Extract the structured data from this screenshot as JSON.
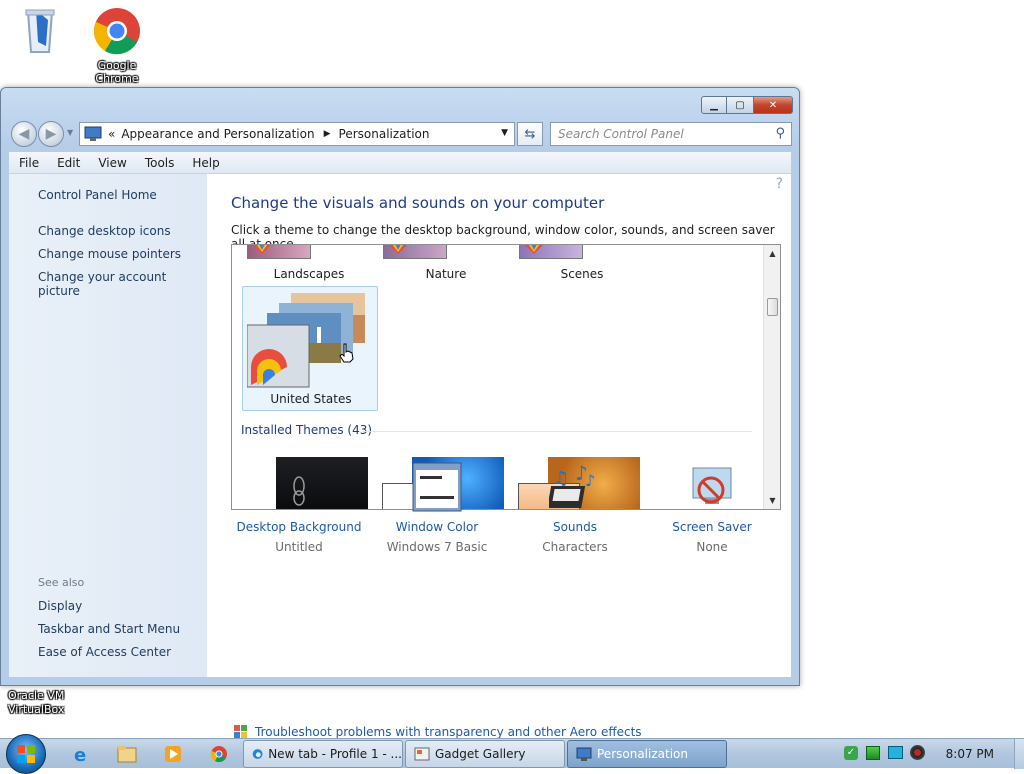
{
  "desktop": {
    "icons": [
      {
        "label": "",
        "icon": "recycle-bin-icon"
      },
      {
        "label": "Google Chrome",
        "icon": "chrome-icon"
      },
      {
        "label": "Oracle VM VirtualBox",
        "icon": "virtualbox-icon"
      }
    ]
  },
  "window": {
    "buttons": {
      "minimize": "minimize",
      "maximize": "maximize",
      "close": "close"
    },
    "address": {
      "chevrons": "«",
      "crumbs": [
        "Appearance and Personalization",
        "Personalization"
      ],
      "separator": "▸"
    },
    "search_placeholder": "Search Control Panel",
    "menu": [
      "File",
      "Edit",
      "View",
      "Tools",
      "Help"
    ],
    "left_links": [
      "Control Panel Home",
      "Change desktop icons",
      "Change mouse pointers",
      "Change your account picture"
    ],
    "see_also": {
      "heading": "See also",
      "links": [
        "Display",
        "Taskbar and Start Menu",
        "Ease of Access Center"
      ]
    },
    "main": {
      "title": "Change the visuals and sounds on your computer",
      "subtitle": "Click a theme to change the desktop background, window color, sounds, and screen saver all at once.",
      "themes_row1": [
        "Landscapes",
        "Nature",
        "Scenes"
      ],
      "selected_theme": "United States",
      "installed_label": "Installed Themes (43)",
      "options": [
        {
          "link": "Desktop Background",
          "sub": "Untitled",
          "icon": "desktop-background-icon"
        },
        {
          "link": "Window Color",
          "sub": "Windows 7 Basic",
          "icon": "window-color-icon"
        },
        {
          "link": "Sounds",
          "sub": "Characters",
          "icon": "sounds-icon"
        },
        {
          "link": "Screen Saver",
          "sub": "None",
          "icon": "screen-saver-icon"
        }
      ],
      "troubleshoot": "Troubleshoot problems with transparency and other Aero effects"
    }
  },
  "taskbar": {
    "pinned": [
      "internet-explorer-icon",
      "explorer-icon",
      "media-player-icon",
      "chrome-icon"
    ],
    "tasks": [
      {
        "label": "New tab - Profile 1 - ...",
        "icon": "edge-icon",
        "active": false
      },
      {
        "label": "Gadget Gallery",
        "icon": "gadget-icon",
        "active": false
      },
      {
        "label": "Personalization",
        "icon": "personalization-icon",
        "active": true
      }
    ],
    "clock": "8:07 PM"
  }
}
